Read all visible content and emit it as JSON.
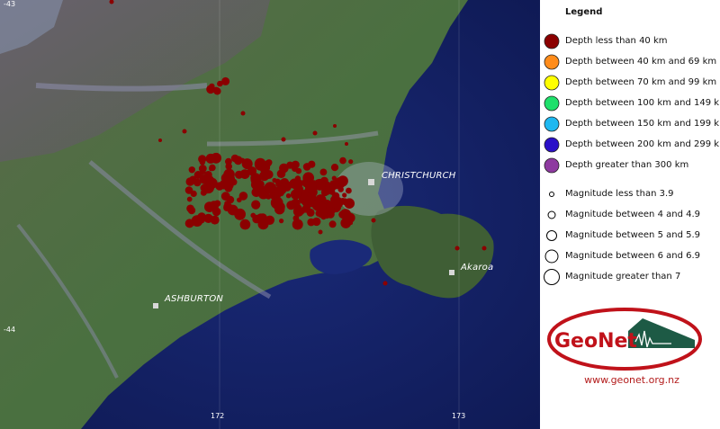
{
  "legend": {
    "title": "Legend",
    "depth_items": [
      {
        "label": "Depth less than 40 km",
        "color": "#8b0000"
      },
      {
        "label": "Depth between 40 km and 69 km",
        "color": "#ff8c1a"
      },
      {
        "label": "Depth between 70 km and 99 km",
        "color": "#ffff00"
      },
      {
        "label": "Depth between 100 km and 149 km",
        "color": "#1fe06b"
      },
      {
        "label": "Depth between 150 km and 199 km",
        "color": "#1eb8f0"
      },
      {
        "label": "Depth between 200 km and 299 km",
        "color": "#2a10c8"
      },
      {
        "label": "Depth greater than 300 km",
        "color": "#8e3aa0"
      }
    ],
    "magnitude_items": [
      {
        "label": "Magnitude less than 3.9"
      },
      {
        "label": "Magnitude between 4 and 4.9"
      },
      {
        "label": "Magnitude between 5 and 5.9"
      },
      {
        "label": "Magnitude between 6 and 6.9"
      },
      {
        "label": "Magnitude greater than 7"
      }
    ]
  },
  "map": {
    "cities": {
      "christchurch": "CHRISTCHURCH",
      "akaroa": "Akaroa",
      "ashburton": "ASHBURTON"
    },
    "ticks": {
      "lat_top": "-43",
      "lat_bottom": "-44",
      "lon_left": "172",
      "lon_right": "173"
    },
    "quake_color": "#8b0000"
  },
  "logo": {
    "text": "GeoNet",
    "url": "www.geonet.org.nz",
    "color_red": "#c0121a",
    "color_green": "#1d5a45"
  }
}
